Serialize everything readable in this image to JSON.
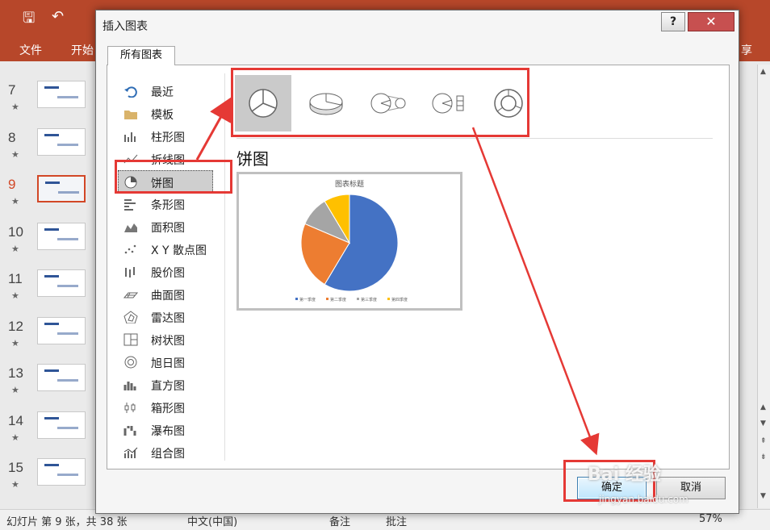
{
  "app": {
    "share_label": "享",
    "file_tab": "文件",
    "home_tab": "开始"
  },
  "slides": [
    {
      "num": "7",
      "star": "★"
    },
    {
      "num": "8",
      "star": "★"
    },
    {
      "num": "9",
      "star": "★",
      "active": true
    },
    {
      "num": "10",
      "star": "★"
    },
    {
      "num": "11",
      "star": "★"
    },
    {
      "num": "12",
      "star": "★"
    },
    {
      "num": "13",
      "star": "★"
    },
    {
      "num": "14",
      "star": "★"
    },
    {
      "num": "15",
      "star": "★"
    }
  ],
  "status": {
    "slide_info": "幻灯片 第 9 张，共 38 张",
    "language": "中文(中国)",
    "notes": "备注",
    "comments": "批注",
    "zoom": "57%"
  },
  "dialog": {
    "title": "插入图表",
    "help": "?",
    "close": "✕",
    "tab": "所有图表",
    "categories": [
      {
        "label": "最近",
        "icon": "recent-icon"
      },
      {
        "label": "模板",
        "icon": "folder-icon"
      },
      {
        "label": "柱形图",
        "icon": "column-chart-icon"
      },
      {
        "label": "折线图",
        "icon": "line-chart-icon"
      },
      {
        "label": "饼图",
        "icon": "pie-chart-icon",
        "selected": true
      },
      {
        "label": "条形图",
        "icon": "bar-chart-icon"
      },
      {
        "label": "面积图",
        "icon": "area-chart-icon"
      },
      {
        "label": "X Y 散点图",
        "icon": "scatter-chart-icon"
      },
      {
        "label": "股价图",
        "icon": "stock-chart-icon"
      },
      {
        "label": "曲面图",
        "icon": "surface-chart-icon"
      },
      {
        "label": "雷达图",
        "icon": "radar-chart-icon"
      },
      {
        "label": "树状图",
        "icon": "treemap-chart-icon"
      },
      {
        "label": "旭日图",
        "icon": "sunburst-chart-icon"
      },
      {
        "label": "直方图",
        "icon": "histogram-chart-icon"
      },
      {
        "label": "箱形图",
        "icon": "box-chart-icon"
      },
      {
        "label": "瀑布图",
        "icon": "waterfall-chart-icon"
      },
      {
        "label": "组合图",
        "icon": "combo-chart-icon"
      }
    ],
    "subtypes": [
      "pie-icon",
      "3d-pie-icon",
      "pie-of-pie-icon",
      "bar-of-pie-icon",
      "doughnut-icon"
    ],
    "selected_type_title": "饼图",
    "ok_label": "确定",
    "cancel_label": "取消"
  },
  "chart_data": {
    "type": "pie",
    "title": "图表标题",
    "categories": [
      "第一季度",
      "第二季度",
      "第三季度",
      "第四季度"
    ],
    "values": [
      8.2,
      3.2,
      1.4,
      1.2
    ],
    "colors": [
      "#4472c4",
      "#ed7d31",
      "#a5a5a5",
      "#ffc000"
    ],
    "legend_position": "bottom"
  },
  "watermark": {
    "text": "Bai 经验",
    "sub": "jingyan.baidu.com"
  }
}
